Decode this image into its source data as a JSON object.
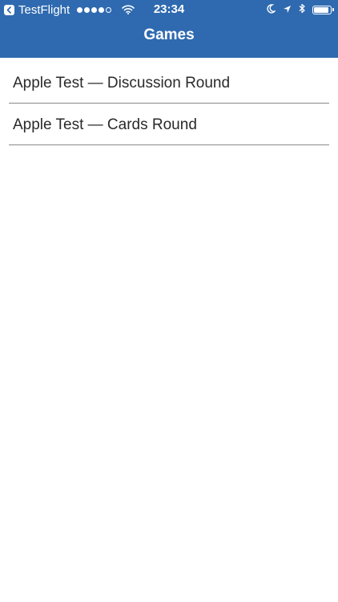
{
  "status_bar": {
    "back_app": "TestFlight",
    "time": "23:34",
    "signal_dots_filled": 4,
    "signal_dots_total": 5,
    "battery_level": 0.9,
    "icons": [
      "back-arrow-icon",
      "wifi-icon",
      "moon-icon",
      "location-arrow-icon",
      "bluetooth-icon",
      "battery-icon"
    ]
  },
  "header": {
    "title": "Games"
  },
  "colors": {
    "header_bg": "#2f6ab0",
    "separator": "#8a8a8a",
    "row_text": "#2a2a2a"
  },
  "games": [
    {
      "label": "Apple Test — Discussion Round"
    },
    {
      "label": "Apple Test — Cards Round"
    }
  ]
}
